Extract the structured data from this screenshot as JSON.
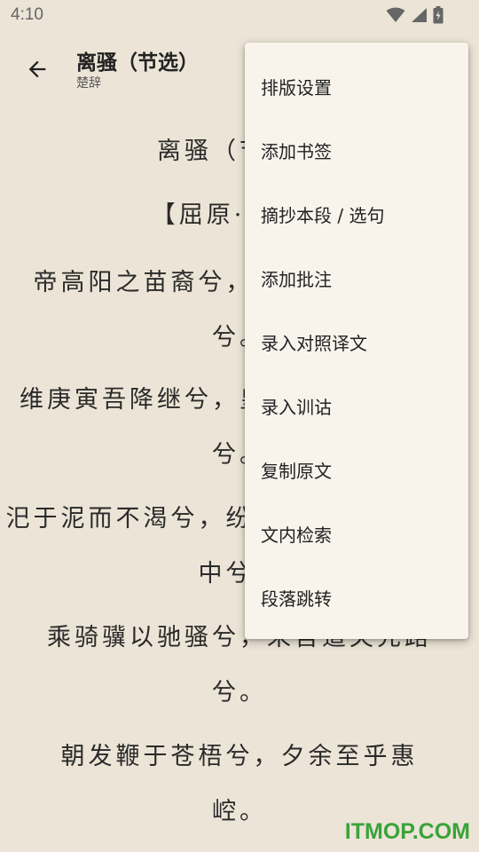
{
  "status_bar": {
    "time": "4:10"
  },
  "header": {
    "title": "离骚（节选）",
    "subtitle": "楚辞"
  },
  "content": {
    "lines": [
      "离骚（节选）",
      "【屈原·先秦】",
      "帝高阳之苗裔兮，朕皇考曰伯庸。",
      "兮。",
      "维庚寅吾降继兮，皇览揆余初度兮。",
      "兮。",
      "汜于泥而不渴兮，纷吾既有此内美兮，",
      "中兮。",
      "乘骑骥以驰骚兮，来吾道夫先路",
      "兮。",
      "朝发鞭于苍梧兮，夕余至乎惠",
      "崆。"
    ]
  },
  "menu": {
    "items": [
      "排版设置",
      "添加书签",
      "摘抄本段 / 选句",
      "添加批注",
      "录入对照译文",
      "录入训诂",
      "复制原文",
      "文内检索",
      "段落跳转"
    ]
  },
  "watermark": "ITMOP.COM",
  "colors": {
    "background": "#ece4d6",
    "menu": "#f8f4ec",
    "watermark": "#3aa33a"
  }
}
